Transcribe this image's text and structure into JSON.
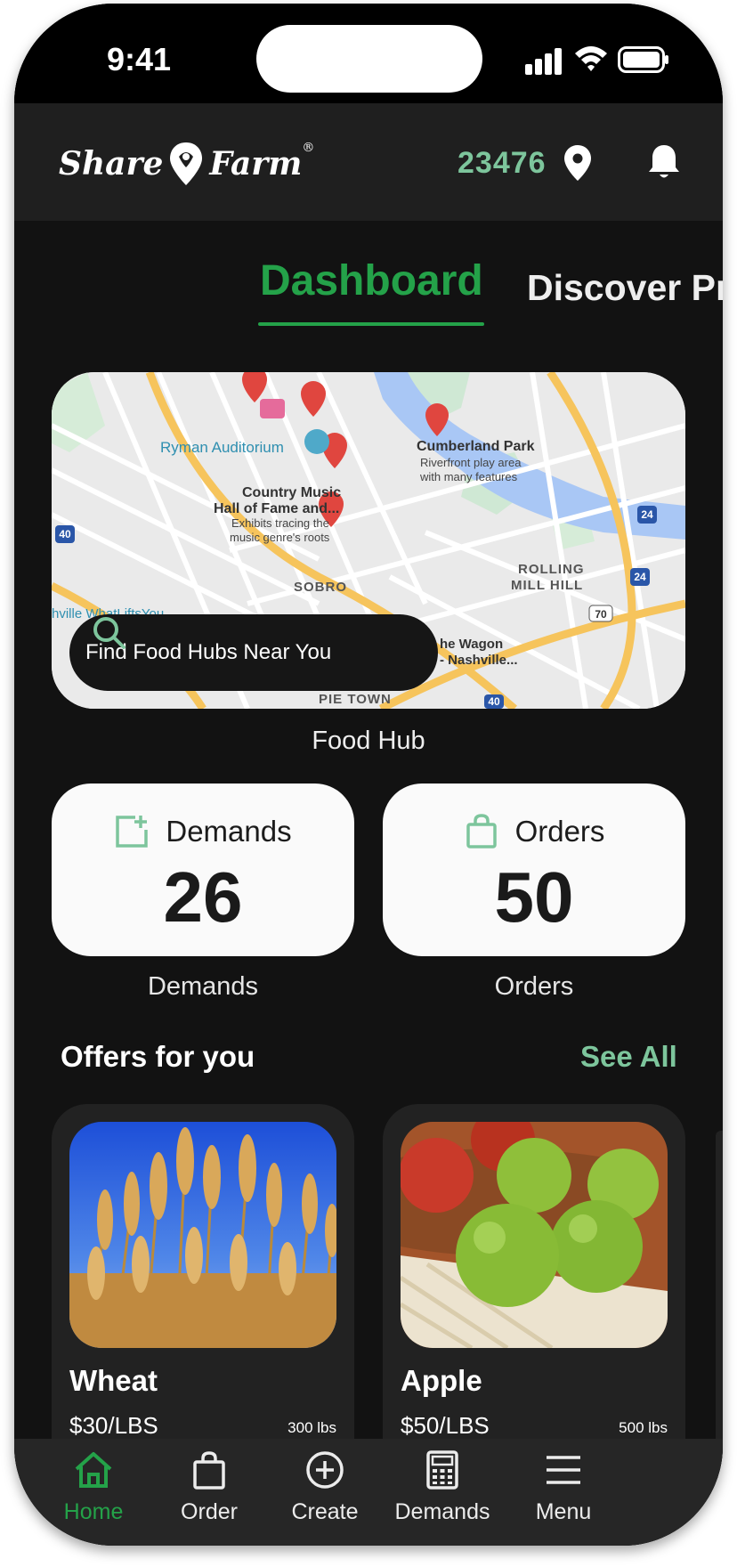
{
  "status_bar": {
    "time": "9:41"
  },
  "header": {
    "logo_left": "Share",
    "logo_right": "Farm",
    "logo_mark": "®",
    "zip_code": "23476",
    "location_icon": "map-pin-icon",
    "notification_icon": "bell-icon"
  },
  "tabs": {
    "active": "Dashboard",
    "next": "Discover Pr"
  },
  "map": {
    "labels": {
      "ryman": "Ryman Auditorium",
      "cumberland": "Cumberland Park",
      "cumberland_sub1": "Riverfront play area",
      "cumberland_sub2": "with many features",
      "country1": "Country Music",
      "country2": "Hall of Fame and...",
      "country_sub1": "Exhibits tracing the",
      "country_sub2": "music genre's roots",
      "sobro": "SOBRO",
      "rolling1": "ROLLING",
      "rolling2": "MILL HILL",
      "whatlifts": "hville WhatLiftsYou",
      "wagon1": "he Wagon",
      "wagon2": "- Nashville...",
      "pie_town": "PIE TOWN",
      "i40_left": "40",
      "i40_bottom": "40",
      "i24_top": "24",
      "i24_bottom": "24",
      "us70": "70"
    },
    "search_label": "Find Food Hubs Near You",
    "caption": "Food Hub"
  },
  "stats": {
    "demands": {
      "title": "Demands",
      "value": "26",
      "caption": "Demands"
    },
    "orders": {
      "title": "Orders",
      "value": "50",
      "caption": "Orders"
    }
  },
  "offers": {
    "title": "Offers for you",
    "see_all": "See All",
    "items": [
      {
        "name": "Wheat",
        "price": "$30/LBS",
        "qty": "300 lbs"
      },
      {
        "name": "Apple",
        "price": "$50/LBS",
        "qty": "500 lbs"
      }
    ]
  },
  "nav": {
    "items": [
      {
        "label": "Home",
        "icon": "home-icon"
      },
      {
        "label": "Order",
        "icon": "shopping-bag-icon"
      },
      {
        "label": "Create",
        "icon": "plus-circle-icon"
      },
      {
        "label": "Demands",
        "icon": "calculator-icon"
      },
      {
        "label": "Menu",
        "icon": "menu-icon"
      }
    ]
  },
  "colors": {
    "brand_green": "#24a249",
    "accent_green": "#7dc59c",
    "background": "#121212"
  }
}
